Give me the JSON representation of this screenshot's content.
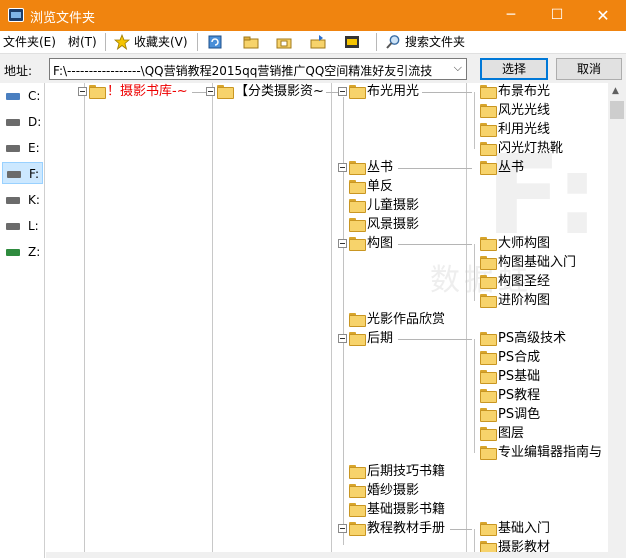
{
  "window": {
    "title": "浏览文件夹",
    "min": "─",
    "max": "☐",
    "close": "✕"
  },
  "toolbar": {
    "menu_folder": "文件夹(E)",
    "menu_tree": "树(T)",
    "favorites": "收藏夹(V)",
    "search_folder": "搜索文件夹"
  },
  "address": {
    "label": "地址:",
    "value": "F:\\-----------------\\QQ营销教程2015qq营销推广QQ空间精准好友引流技",
    "arrow": "⌵",
    "select_button": "选择",
    "cancel_button": "取消"
  },
  "drives": [
    "C:",
    "D:",
    "E:",
    "F:",
    "K:",
    "L:",
    "Z:"
  ],
  "tree": {
    "root": "！摄影书库-~",
    "category": "【分类摄影资~",
    "level2": [
      "布光用光",
      "丛书",
      "单反",
      "儿童摄影",
      "风景摄影",
      "构图",
      "光影作品欣赏",
      "后期",
      "后期技巧书籍",
      "婚纱摄影",
      "基础摄影书籍",
      "教程教材手册"
    ],
    "lighting": [
      "布景布光",
      "风光光线",
      "利用光线",
      "闪光灯热靴"
    ],
    "series": [
      "丛书"
    ],
    "composition": [
      "大师构图",
      "构图基础入门",
      "构图圣经",
      "进阶构图"
    ],
    "post": [
      "PS高级技术",
      "PS合成",
      "PS基础",
      "PS教程",
      "PS调色",
      "图层",
      "专业编辑器指南与"
    ],
    "tutorial": [
      "基础入门",
      "摄影教材"
    ]
  },
  "watermark": {
    "big": "F:",
    "text": "数据蛙"
  },
  "scrollbar": {
    "up": "▲"
  }
}
